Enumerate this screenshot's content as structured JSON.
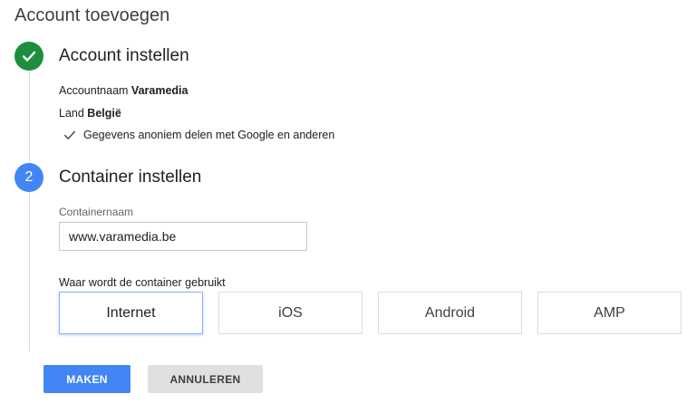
{
  "page": {
    "title": "Account toevoegen"
  },
  "step1": {
    "title": "Account instellen",
    "account_label": "Accountnaam",
    "account_value": "Varamedia",
    "country_label": "Land",
    "country_value": "België",
    "share_text": "Gegevens anoniem delen met Google en anderen"
  },
  "step2": {
    "number": "2",
    "title": "Container instellen",
    "container_label": "Containernaam",
    "container_value": "www.varamedia.be",
    "usage_label": "Waar wordt de container gebruikt",
    "options": [
      {
        "label": "Internet",
        "selected": true
      },
      {
        "label": "iOS",
        "selected": false
      },
      {
        "label": "Android",
        "selected": false
      },
      {
        "label": "AMP",
        "selected": false
      }
    ]
  },
  "actions": {
    "create_label": "MAKEN",
    "cancel_label": "ANNULEREN"
  },
  "colors": {
    "done": "#1e8e3e",
    "active": "#4285f4"
  }
}
